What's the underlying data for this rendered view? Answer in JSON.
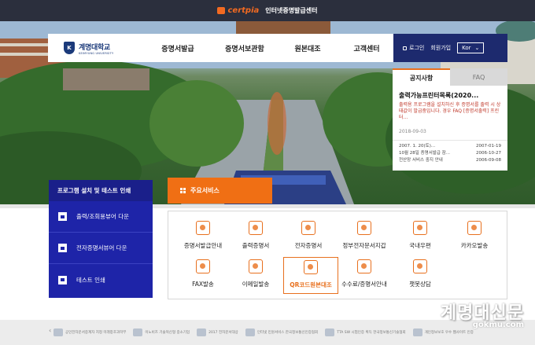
{
  "topbar": {
    "brand": "certpia",
    "title": "인터넷증명발급센터"
  },
  "nav": {
    "logo_ko": "계명대학교",
    "logo_en": "KEIMYUNG UNIVERSITY",
    "menu": [
      "증명서발급",
      "증명서보관함",
      "원본대조",
      "고객센터"
    ],
    "login": "로그인",
    "signup": "회원가입",
    "lang": "Kor"
  },
  "notice": {
    "tabs": [
      "공지사항",
      "FAQ"
    ],
    "headline": "출력가능프린터목록(2020...",
    "body": "출력용 프로그램을 설치하신 후 증명서를 출력 시 상태값이 발급중입니다. 경우 FAQ [증명서출력] 프린터...",
    "date": "2018-09-03",
    "items": [
      {
        "title": "2007. 1. 20(토)...",
        "date": "2007-01-19"
      },
      {
        "title": "10월 28일 증명서발급 잠...",
        "date": "2006-10-27"
      },
      {
        "title": "전산망 서비스 중지 안내",
        "date": "2006-09-08"
      }
    ]
  },
  "install": {
    "title": "프로그램 설치 및 테스트 인쇄",
    "items": [
      "출력/조회용뷰어 다운",
      "전자증명서뷰어 다운",
      "테스트 인쇄"
    ]
  },
  "services": {
    "tab": "주요서비스",
    "items": [
      "증명서발급안내",
      "출력증명서",
      "전자증명서",
      "정부전자문서지갑",
      "국내우편",
      "카카오발송",
      "FAX발송",
      "이메일발송",
      "QR코드원본대조",
      "수수료/증명서안내",
      "챗봇상담"
    ]
  },
  "partners": [
    "공인전자문서중계자 지정 미래창조과학부",
    "이노비즈 기술혁신형 중소기업",
    "2017 전자문서대상",
    "인터넷 민원서비스 한국정보통신인증협회",
    "TTA SW 시험인증 획득 한국정보통신기술협회",
    "개인정보보호 우수 웹사이트 인증"
  ],
  "watermark": {
    "main": "계명대신문",
    "sub": "gokmu.com"
  },
  "colors": {
    "accent": "#f06f14",
    "navy": "#1d2a6e",
    "install_blue": "#1e24a8"
  }
}
